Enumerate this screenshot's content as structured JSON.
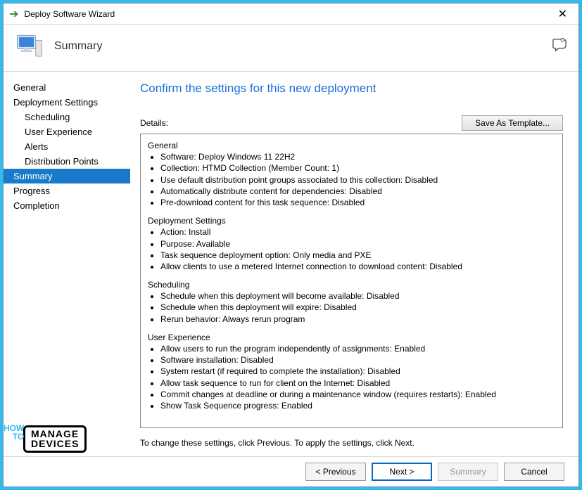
{
  "titlebar": {
    "title": "Deploy Software Wizard"
  },
  "header": {
    "page_title": "Summary"
  },
  "sidebar": {
    "items": [
      {
        "label": "General",
        "sub": false,
        "selected": false
      },
      {
        "label": "Deployment Settings",
        "sub": false,
        "selected": false
      },
      {
        "label": "Scheduling",
        "sub": true,
        "selected": false
      },
      {
        "label": "User Experience",
        "sub": true,
        "selected": false
      },
      {
        "label": "Alerts",
        "sub": true,
        "selected": false
      },
      {
        "label": "Distribution Points",
        "sub": true,
        "selected": false
      },
      {
        "label": "Summary",
        "sub": false,
        "selected": true
      },
      {
        "label": "Progress",
        "sub": false,
        "selected": false
      },
      {
        "label": "Completion",
        "sub": false,
        "selected": false
      }
    ]
  },
  "main": {
    "heading": "Confirm the settings for this new deployment",
    "details_label": "Details:",
    "save_template_label": "Save As Template...",
    "hint": "To change these settings, click Previous. To apply the settings, click Next.",
    "sections": [
      {
        "title": "General",
        "items": [
          "Software: Deploy Windows 11 22H2",
          "Collection: HTMD Collection (Member Count: 1)",
          "Use default distribution point groups associated to this collection: Disabled",
          "Automatically distribute content for dependencies: Disabled",
          "Pre-download content for this task sequence: Disabled"
        ]
      },
      {
        "title": "Deployment Settings",
        "items": [
          "Action: Install",
          "Purpose: Available",
          "Task sequence deployment option: Only media and PXE",
          "Allow clients to use a metered Internet connection to download content: Disabled"
        ]
      },
      {
        "title": "Scheduling",
        "items": [
          "Schedule when this deployment will become available: Disabled",
          "Schedule when this deployment will expire: Disabled",
          "Rerun behavior: Always rerun program"
        ]
      },
      {
        "title": "User Experience",
        "items": [
          "Allow users to run the program independently of assignments: Enabled",
          "Software installation: Disabled",
          "System restart (if required to complete the installation): Disabled",
          "Allow task sequence to run for client on the Internet: Disabled",
          "Commit changes at deadline or during a maintenance window (requires restarts): Enabled",
          "Show Task Sequence progress: Enabled"
        ]
      }
    ]
  },
  "footer": {
    "previous": "< Previous",
    "next": "Next >",
    "summary": "Summary",
    "cancel": "Cancel"
  },
  "watermark": {
    "side1": "HOW",
    "side2": "TO",
    "box1": "MANAGE",
    "box2": "DEVICES"
  }
}
